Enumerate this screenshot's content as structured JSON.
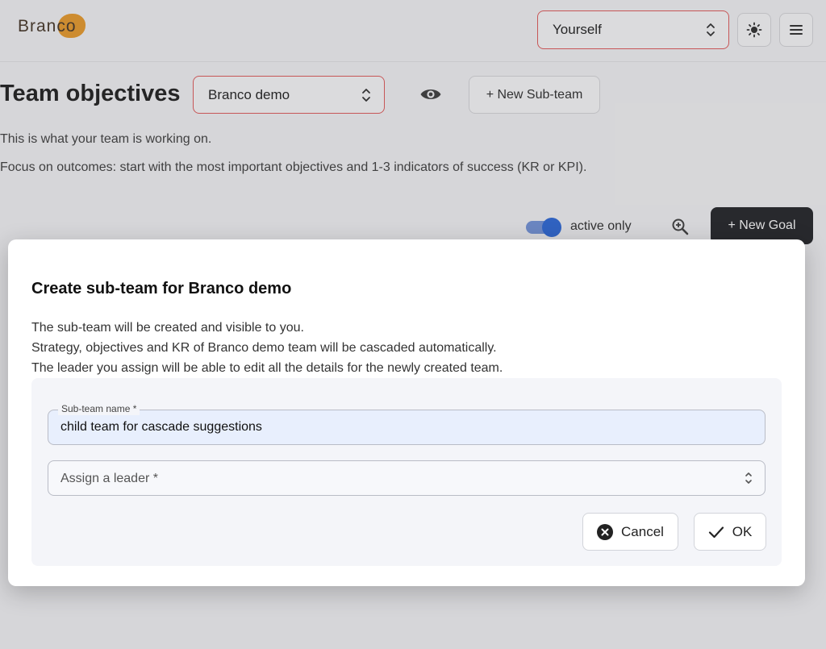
{
  "colors": {
    "accent": "#1f5fd6",
    "error_border": "#e05050",
    "logo_orange": "#e8951e",
    "dark_button": "#15161a"
  },
  "header": {
    "logo_text": "Branco",
    "user_select_value": "Yourself",
    "theme_icon": "sun-icon",
    "menu_icon": "hamburger-icon"
  },
  "page": {
    "title": "Team objectives",
    "team_select_value": "Branco demo",
    "visibility_icon": "eye-icon",
    "new_subteam_label": "+ New Sub-team",
    "description_1": "This is what your team is working on.",
    "description_2": "Focus on outcomes: start with the most important objectives and 1-3 indicators of success (KR or KPI).",
    "active_only_label": "active only",
    "active_only_on": true,
    "zoom_icon": "zoom-in-icon",
    "new_goal_label": "+ New Goal"
  },
  "modal": {
    "title": "Create sub-team for Branco demo",
    "desc_1": "The sub-team will be created and visible to you.",
    "desc_2": "Strategy, objectives and KR of Branco demo team will be cascaded automatically.",
    "desc_3": "The leader you assign will be able to edit all the details for the newly created team.",
    "name_label": "Sub-team name *",
    "name_value": "child team for cascade suggestions",
    "leader_placeholder": "Assign a leader *",
    "cancel_label": "Cancel",
    "cancel_icon": "close-circle-icon",
    "ok_label": "OK",
    "ok_icon": "check-icon"
  }
}
